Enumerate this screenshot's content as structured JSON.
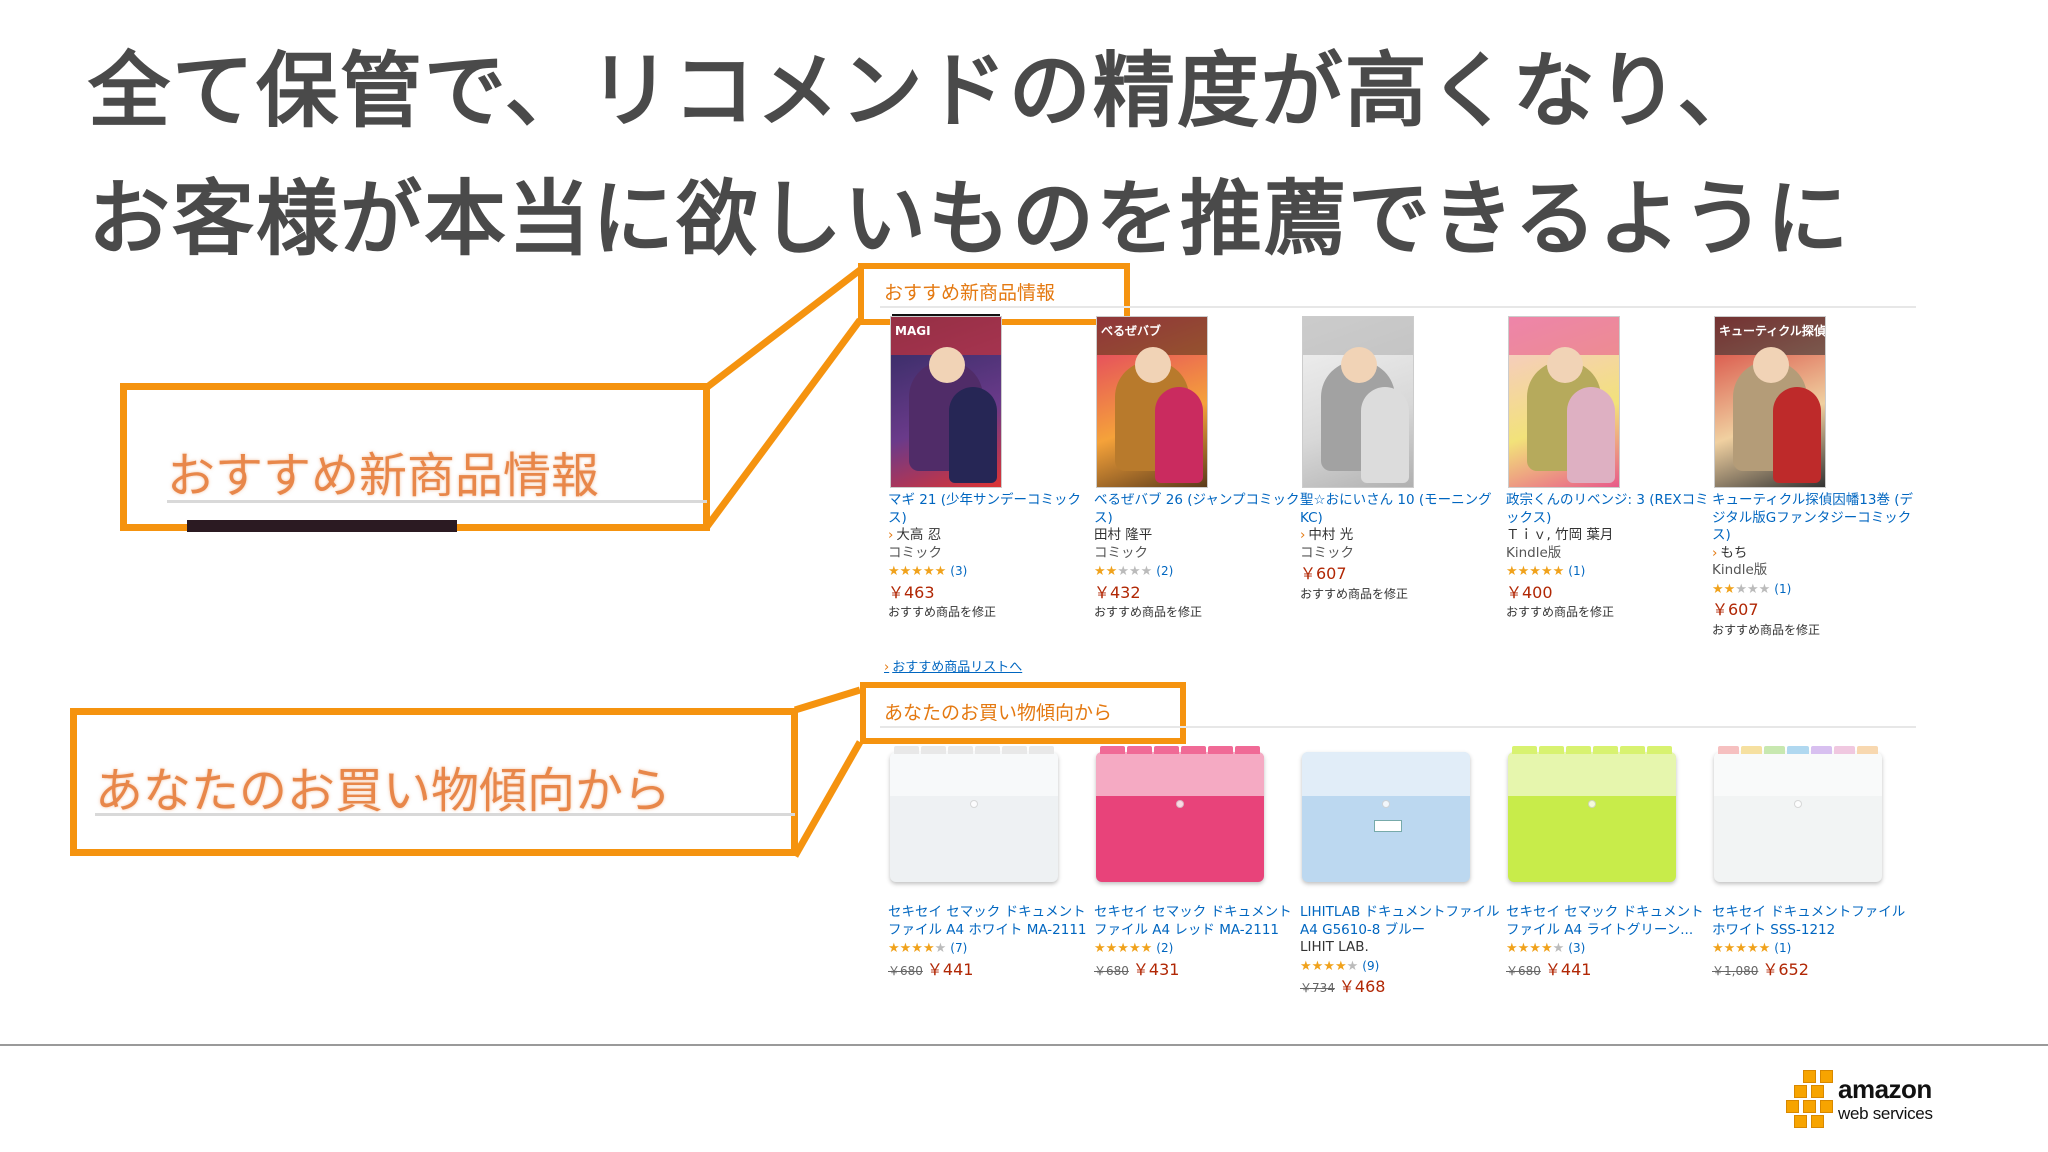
{
  "slide": {
    "title_lines": [
      "全て保管で、リコメンドの精度が高くなり、",
      "お客様が本当に欲しいものを推薦できるように"
    ]
  },
  "callouts": {
    "new_items": "おすすめ新商品情報",
    "shopping_trend": "あなたのお買い物傾向から"
  },
  "section_new": {
    "title": "おすすめ新商品情報",
    "see_list": "おすすめ商品リストへ",
    "items": [
      {
        "title": "マギ 21 (少年サンデーコミックス)",
        "author": "大高 忍",
        "author_arrow": true,
        "format": "コミック",
        "stars": 5,
        "reviews": "(3)",
        "price": "￥463",
        "fix": "おすすめ商品を修正",
        "cover_text": "MAGI",
        "colors": [
          "#2a2a5e",
          "#6a3a8a",
          "#d33"
        ]
      },
      {
        "title": "べるぜバブ 26 (ジャンプコミックス)",
        "author": "田村 隆平",
        "author_arrow": false,
        "format": "コミック",
        "stars": 2,
        "reviews": "(2)",
        "price": "￥432",
        "fix": "おすすめ商品を修正",
        "cover_text": "べるぜバブ",
        "colors": [
          "#e0306a",
          "#f5a23a",
          "#5a3a1a"
        ]
      },
      {
        "title": "聖☆おにいさん 10 (モーニングKC)",
        "author": "中村 光",
        "author_arrow": true,
        "format": "コミック",
        "stars": null,
        "reviews": "",
        "price": "￥607",
        "fix": "おすすめ商品を修正",
        "cover_text": "",
        "colors": [
          "#f4f4f4",
          "#d8d8d8",
          "#b0b0b0"
        ]
      },
      {
        "title": "政宗くんのリベンジ: 3 (REXコミックス)",
        "author": "Ｔｉｖ, 竹岡 葉月",
        "author_arrow": false,
        "format": "Kindle版",
        "stars": 5,
        "reviews": "(1)",
        "price": "￥400",
        "fix": "おすすめ商品を修正",
        "cover_text": "",
        "colors": [
          "#f7c4d8",
          "#f2e27a",
          "#e85a8a"
        ]
      },
      {
        "title": "キューティクル探偵因幡13巻 (デジタル版Gファンタジーコミックス)",
        "author": "もち",
        "author_arrow": true,
        "format": "Kindle版",
        "stars": 2,
        "reviews": "(1)",
        "price": "￥607",
        "fix": "おすすめ商品を修正",
        "cover_text": "キューティクル探偵因幡",
        "colors": [
          "#d32f2f",
          "#f0d0a0",
          "#333"
        ]
      }
    ]
  },
  "section_trend": {
    "title": "あなたのお買い物傾向から",
    "items": [
      {
        "title": "セキセイ セマック ドキュメントファイル A4 ホワイト MA-2111",
        "author": "",
        "stars": 4,
        "reviews": "(7)",
        "list_price": "￥680",
        "price": "￥441",
        "color": "#eef1f3",
        "tab_colors": [
          "#e8e8e8",
          "#e8e8e8",
          "#e8e8e8",
          "#e8e8e8",
          "#e8e8e8",
          "#e8e8e8"
        ]
      },
      {
        "title": "セキセイ セマック ドキュメントファイル A4 レッド MA-2111",
        "author": "",
        "stars": 5,
        "reviews": "(2)",
        "list_price": "￥680",
        "price": "￥431",
        "color": "#e8437a",
        "tab_colors": [
          "#f06a96",
          "#f06a96",
          "#f06a96",
          "#f06a96",
          "#f06a96",
          "#f06a96"
        ]
      },
      {
        "title": "LIHITLAB ドキュメントファイル A4 G5610-8 ブルー",
        "author": "LIHIT LAB.",
        "stars": 4,
        "reviews": "(9)",
        "list_price": "￥734",
        "price": "￥468",
        "color": "#bcd8f0",
        "tab_colors": []
      },
      {
        "title": "セキセイ セマック ドキュメントファイル A4 ライトグリーン...",
        "author": "",
        "stars": 4,
        "reviews": "(3)",
        "list_price": "￥680",
        "price": "￥441",
        "color": "#c8ec4a",
        "tab_colors": [
          "#d8f270",
          "#d8f270",
          "#d8f270",
          "#d8f270",
          "#d8f270",
          "#d8f270"
        ]
      },
      {
        "title": "セキセイ ドキュメントファイル ホワイト SSS-1212",
        "author": "",
        "stars": 5,
        "reviews": "(1)",
        "list_price": "￥1,080",
        "price": "￥652",
        "color": "#f2f4f4",
        "tab_colors": [
          "#f6c0c0",
          "#f6e0a0",
          "#c8e8b0",
          "#b0d8f0",
          "#d8c0f0",
          "#f0c8e0",
          "#f8d8b0"
        ]
      }
    ]
  },
  "footer": {
    "logo_word": "amazon",
    "logo_sub": "web services"
  },
  "colors": {
    "accent_orange": "#f5930f",
    "amazon_link": "#0066c0",
    "price_red": "#b12704",
    "section_title": "#e47911"
  }
}
